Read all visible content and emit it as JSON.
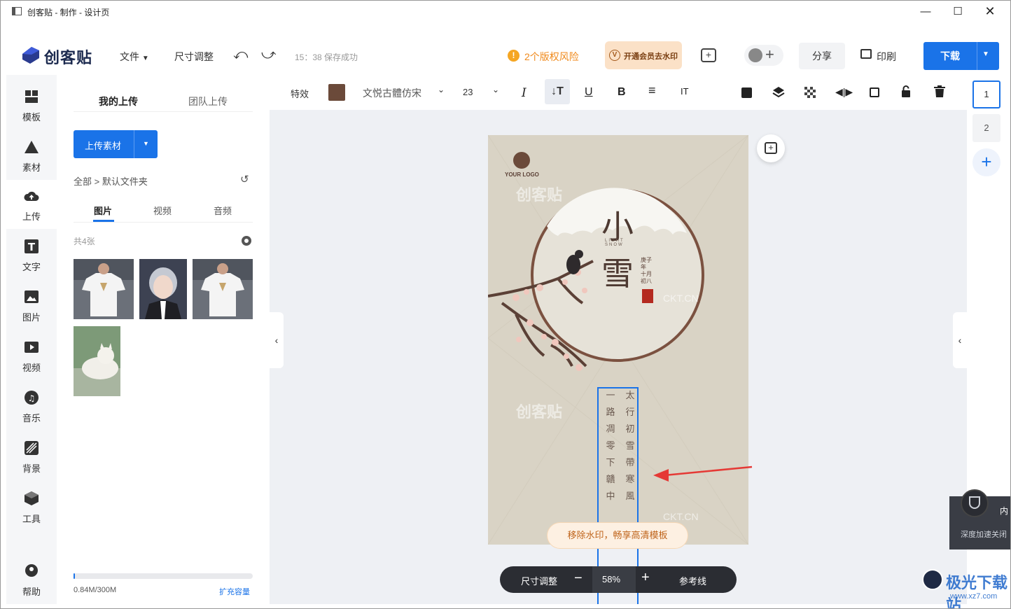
{
  "window": {
    "title": "创客贴 - 制作 - 设计页"
  },
  "header": {
    "brand": "创客贴",
    "file_menu": "文件",
    "resize": "尺寸调整",
    "save_status": "15：38 保存成功",
    "copyright_risk": "2个版权风险",
    "vip_button": "开通会员去水印",
    "share": "分享",
    "print": "印刷",
    "download": "下载"
  },
  "rail": {
    "items": [
      {
        "label": "模板",
        "icon": "template-icon"
      },
      {
        "label": "素材",
        "icon": "material-icon"
      },
      {
        "label": "上传",
        "icon": "upload-icon"
      },
      {
        "label": "文字",
        "icon": "text-icon"
      },
      {
        "label": "图片",
        "icon": "image-icon"
      },
      {
        "label": "视频",
        "icon": "video-icon"
      },
      {
        "label": "音乐",
        "icon": "music-icon"
      },
      {
        "label": "背景",
        "icon": "background-icon"
      },
      {
        "label": "工具",
        "icon": "tools-icon"
      }
    ],
    "help": "帮助"
  },
  "panel": {
    "tabs": [
      "我的上传",
      "团队上传"
    ],
    "upload_button": "上传素材",
    "breadcrumb": "全部 > 默认文件夹",
    "media_tabs": [
      "图片",
      "视频",
      "音频"
    ],
    "count": "共4张",
    "storage": "0.84M/300M",
    "expand": "扩充容量"
  },
  "toolbar": {
    "effects": "特效",
    "font": "文悦古體仿宋",
    "size": "23",
    "text_color": "#6b4a3a"
  },
  "canvas": {
    "zoom": "58%",
    "resize": "尺寸调整",
    "guides": "参考线",
    "remove_watermark": "移除水印，畅享高清模板"
  },
  "poster": {
    "logo": "YOUR LOGO",
    "title1": "小",
    "title2": "雪",
    "subtitle": "LIGHT SNOW",
    "date": "庚子年 十月 初八",
    "watermark": "创客贴",
    "watermark2": "CKT.CN",
    "poem_col1": [
      "太",
      "行",
      "初",
      "雪",
      "帶",
      "寒",
      "風"
    ],
    "poem_col2": [
      "一",
      "路",
      "凋",
      "零",
      "下",
      "贛",
      "中"
    ]
  },
  "pages": [
    "1",
    "2"
  ],
  "popup": {
    "line1": "内",
    "line2": "深度加速关闭"
  },
  "watermark_site": "极光下载站",
  "watermark_url": "www.xz7.com",
  "colors": {
    "primary": "#1a73e8",
    "accent_red": "#e53935",
    "warning": "#f5a623"
  }
}
